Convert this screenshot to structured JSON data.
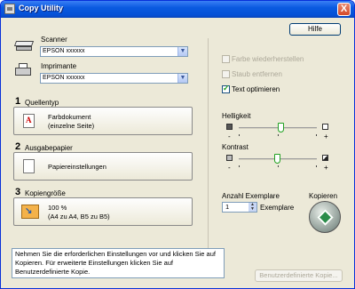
{
  "window": {
    "title": "Copy Utility",
    "close": "X"
  },
  "help_button": "Hilfe",
  "scanner": {
    "label": "Scanner",
    "value": "EPSON xxxxxx"
  },
  "printer": {
    "label": "Imprimante",
    "value": "EPSON xxxxxx"
  },
  "sections": [
    {
      "number": "1",
      "title": "Quellentyp",
      "button_lines": [
        "Farbdokument",
        "(einzelne Seite)"
      ]
    },
    {
      "number": "2",
      "title": "Ausgabepapier",
      "button_lines": [
        "Papiereinstellungen"
      ]
    },
    {
      "number": "3",
      "title": "Kopiengröße",
      "button_lines": [
        "100 %",
        "(A4 zu A4, B5 zu B5)"
      ]
    }
  ],
  "options": [
    {
      "label": "Farbe wiederherstellen",
      "checked": false,
      "enabled": false
    },
    {
      "label": "Staub entfernen",
      "checked": false,
      "enabled": false
    },
    {
      "label": "Text optimieren",
      "checked": true,
      "enabled": true
    }
  ],
  "brightness": {
    "label": "Helligkeit",
    "minus": "-",
    "plus": "+",
    "level_fraction": 0.55
  },
  "contrast": {
    "label": "Kontrast",
    "minus": "-",
    "plus": "+",
    "level_fraction": 0.5
  },
  "copies": {
    "label": "Anzahl Exemplare",
    "value": "1",
    "unit": "Exemplare"
  },
  "copy_button_label": "Kopieren",
  "message": "Nehmen Sie die erforderlichen Einstellungen vor und klicken Sie auf Kopieren.  Für erweiterte Einstellungen klicken Sie auf Benutzerdefinierte Kopie.",
  "custom_copy_button": "Benutzerdefinierte Kopie..."
}
